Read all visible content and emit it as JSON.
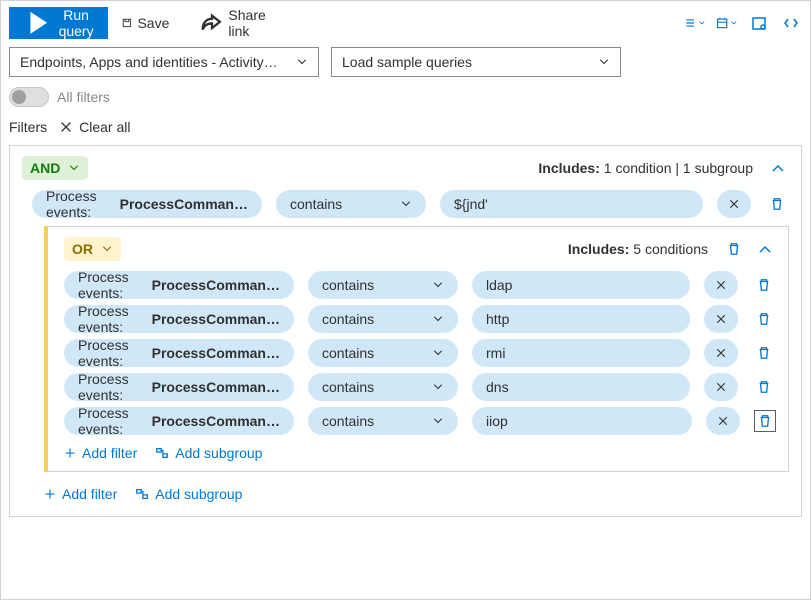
{
  "toolbar": {
    "run": "Run query",
    "save": "Save",
    "share": "Share link"
  },
  "scope": {
    "label": "Endpoints, Apps and identities - Activity…"
  },
  "samples": {
    "label": "Load sample queries"
  },
  "allfilters": "All filters",
  "filtersHeader": "Filters",
  "clearAll": "Clear all",
  "andGroup": {
    "label": "AND",
    "summaryPrefix": "Includes: ",
    "summaryCount1": "1",
    "summaryMid": " condition | ",
    "summaryCount2": "1",
    "summarySuffix": " subgroup",
    "row": {
      "fieldPrefix": "Process events: ",
      "fieldBold": "ProcessComman…",
      "operator": "contains",
      "value": "${jnd'"
    }
  },
  "orGroup": {
    "label": "OR",
    "summaryPrefix": "Includes: ",
    "summaryCount": "5",
    "summarySuffix": " conditions",
    "rows": [
      {
        "fieldPrefix": "Process events: ",
        "fieldBold": "ProcessComman…",
        "operator": "contains",
        "value": "ldap"
      },
      {
        "fieldPrefix": "Process events: ",
        "fieldBold": "ProcessComman…",
        "operator": "contains",
        "value": "http"
      },
      {
        "fieldPrefix": "Process events: ",
        "fieldBold": "ProcessComman…",
        "operator": "contains",
        "value": "rmi"
      },
      {
        "fieldPrefix": "Process events: ",
        "fieldBold": "ProcessComman…",
        "operator": "contains",
        "value": "dns"
      },
      {
        "fieldPrefix": "Process events: ",
        "fieldBold": "ProcessComman…",
        "operator": "contains",
        "value": "iiop"
      }
    ]
  },
  "addFilter": "Add filter",
  "addSubgroup": "Add subgroup"
}
